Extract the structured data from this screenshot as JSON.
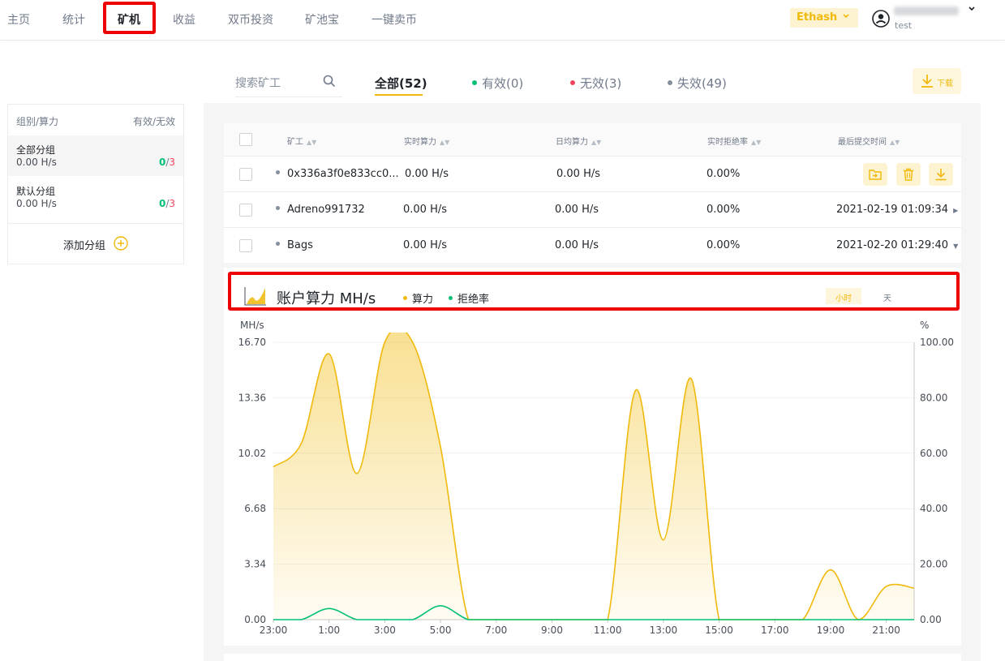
{
  "nav": {
    "items": [
      "主页",
      "统计",
      "矿机",
      "收益",
      "双币投资",
      "矿池宝",
      "一键卖币"
    ],
    "algorithm": "Ethash",
    "user_sub": "test"
  },
  "filter": {
    "search_placeholder": "搜索矿工",
    "tabs": [
      {
        "label": "全部(52)"
      },
      {
        "label": "有效(0)",
        "color": "#02c076"
      },
      {
        "label": "无效(3)",
        "color": "#f6465d"
      },
      {
        "label": "失效(49)",
        "color": "#848e9c"
      }
    ],
    "download_label": "下载"
  },
  "groups": {
    "header_left": "组别/算力",
    "header_right": "有效/无效",
    "items": [
      {
        "name": "全部分组",
        "rate": "0.00 H/s",
        "valid": "0",
        "sep": "/",
        "invalid": "3"
      },
      {
        "name": "默认分组",
        "rate": "0.00 H/s",
        "valid": "0",
        "sep": "/",
        "invalid": "3"
      }
    ],
    "add_label": "添加分组"
  },
  "table": {
    "headers": [
      "矿工",
      "实时算力",
      "日均算力",
      "实时拒绝率",
      "最后提交时间"
    ],
    "rows": [
      {
        "worker": "0x336a3f0e833cc0...",
        "realtime": "0.00 H/s",
        "daily": "0.00 H/s",
        "reject": "0.00%",
        "last": ""
      },
      {
        "worker": "Adreno991732",
        "realtime": "0.00 H/s",
        "daily": "0.00 H/s",
        "reject": "0.00%",
        "last": "2021-02-19 01:09:34"
      },
      {
        "worker": "Bags",
        "realtime": "0.00 H/s",
        "daily": "0.00 H/s",
        "reject": "0.00%",
        "last": "2021-02-20 01:29:40"
      }
    ]
  },
  "chart": {
    "title": "账户算力 MH/s",
    "legend": [
      "算力",
      "拒绝率"
    ],
    "time_buttons": [
      "小时",
      "天"
    ],
    "left_unit": "MH/s",
    "right_unit": "%"
  },
  "colors": {
    "accent": "#f0b90b",
    "green": "#02c076",
    "red": "#f6465d"
  },
  "chart_data": {
    "type": "area",
    "x": [
      "23:00",
      "0:00",
      "1:00",
      "2:00",
      "3:00",
      "4:00",
      "5:00",
      "6:00",
      "7:00",
      "8:00",
      "9:00",
      "10:00",
      "11:00",
      "12:00",
      "13:00",
      "14:00",
      "15:00",
      "16:00",
      "17:00",
      "18:00",
      "19:00",
      "20:00",
      "21:00",
      "22:00"
    ],
    "x_tick_labels": [
      "23:00",
      "1:00",
      "3:00",
      "5:00",
      "7:00",
      "9:00",
      "11:00",
      "13:00",
      "15:00",
      "17:00",
      "19:00",
      "21:00"
    ],
    "left_axis": {
      "label": "MH/s",
      "ticks": [
        "16.70",
        "13.36",
        "10.02",
        "6.68",
        "3.34",
        "0.00"
      ],
      "range": [
        0,
        16.7
      ]
    },
    "right_axis": {
      "label": "%",
      "ticks": [
        "100.00",
        "80.00",
        "60.00",
        "40.00",
        "20.00",
        "0.00"
      ],
      "range": [
        0,
        100
      ]
    },
    "series": [
      {
        "name": "算力",
        "axis": "left",
        "color": "#f0b90b",
        "values": [
          9.2,
          10.6,
          16.0,
          8.8,
          16.7,
          16.7,
          10.4,
          0,
          0,
          0,
          0,
          0,
          0,
          13.8,
          4.8,
          14.5,
          0,
          0,
          0,
          0,
          3.0,
          0,
          2.0,
          1.9
        ]
      },
      {
        "name": "拒绝率",
        "axis": "right",
        "color": "#02c076",
        "values": [
          0,
          0,
          4,
          0,
          0,
          0,
          5,
          0,
          0,
          0,
          0,
          0,
          0,
          0,
          0,
          0,
          0,
          0,
          0,
          0,
          0,
          0,
          0,
          0
        ]
      }
    ],
    "grid": true
  }
}
